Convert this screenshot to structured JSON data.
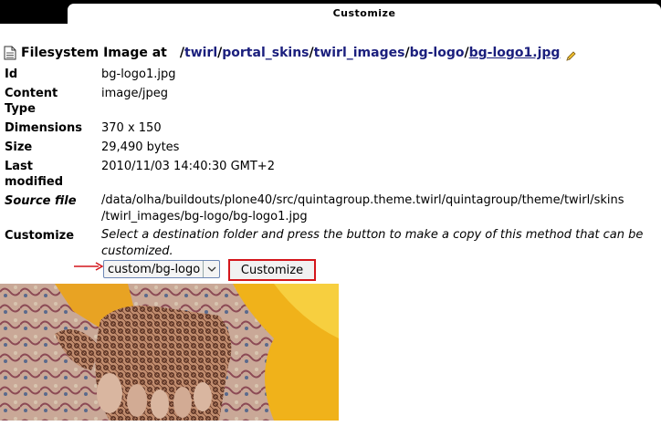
{
  "tab": {
    "label": "Customize"
  },
  "heading": {
    "prefix": "Filesystem Image at",
    "path_parts": [
      "twirl",
      "portal_skins",
      "twirl_images",
      "bg-logo",
      "bg-logo1.jpg"
    ],
    "separator": "/"
  },
  "properties": [
    {
      "label": "Id",
      "value": "bg-logo1.jpg"
    },
    {
      "label": "Content Type",
      "value": "image/jpeg"
    },
    {
      "label": "Dimensions",
      "value": "370 x 150"
    },
    {
      "label": "Size",
      "value": "29,490 bytes"
    },
    {
      "label": "Last modified",
      "value": "2010/11/03 14:40:30 GMT+2"
    },
    {
      "label": "Source file",
      "value": "/data/olha/buildouts/plone40/src/quintagroup.theme.twirl/quintagroup/theme/twirl/skins /twirl_images/bg-logo/bg-logo1.jpg"
    },
    {
      "label": "Customize",
      "value": "Select a destination folder and press the button to make a copy of this method that can be customized."
    }
  ],
  "customize": {
    "folder_selected": "custom/bg-logo",
    "button_label": "Customize"
  },
  "colors": {
    "link": "#1b1f7d",
    "highlight": "#d4161b",
    "topbar": "#000000"
  },
  "icons": {
    "heading": "file-icon",
    "edit": "pencil-icon",
    "dropdown": "chevron-down-icon",
    "pointer": "arrow-right-icon"
  }
}
